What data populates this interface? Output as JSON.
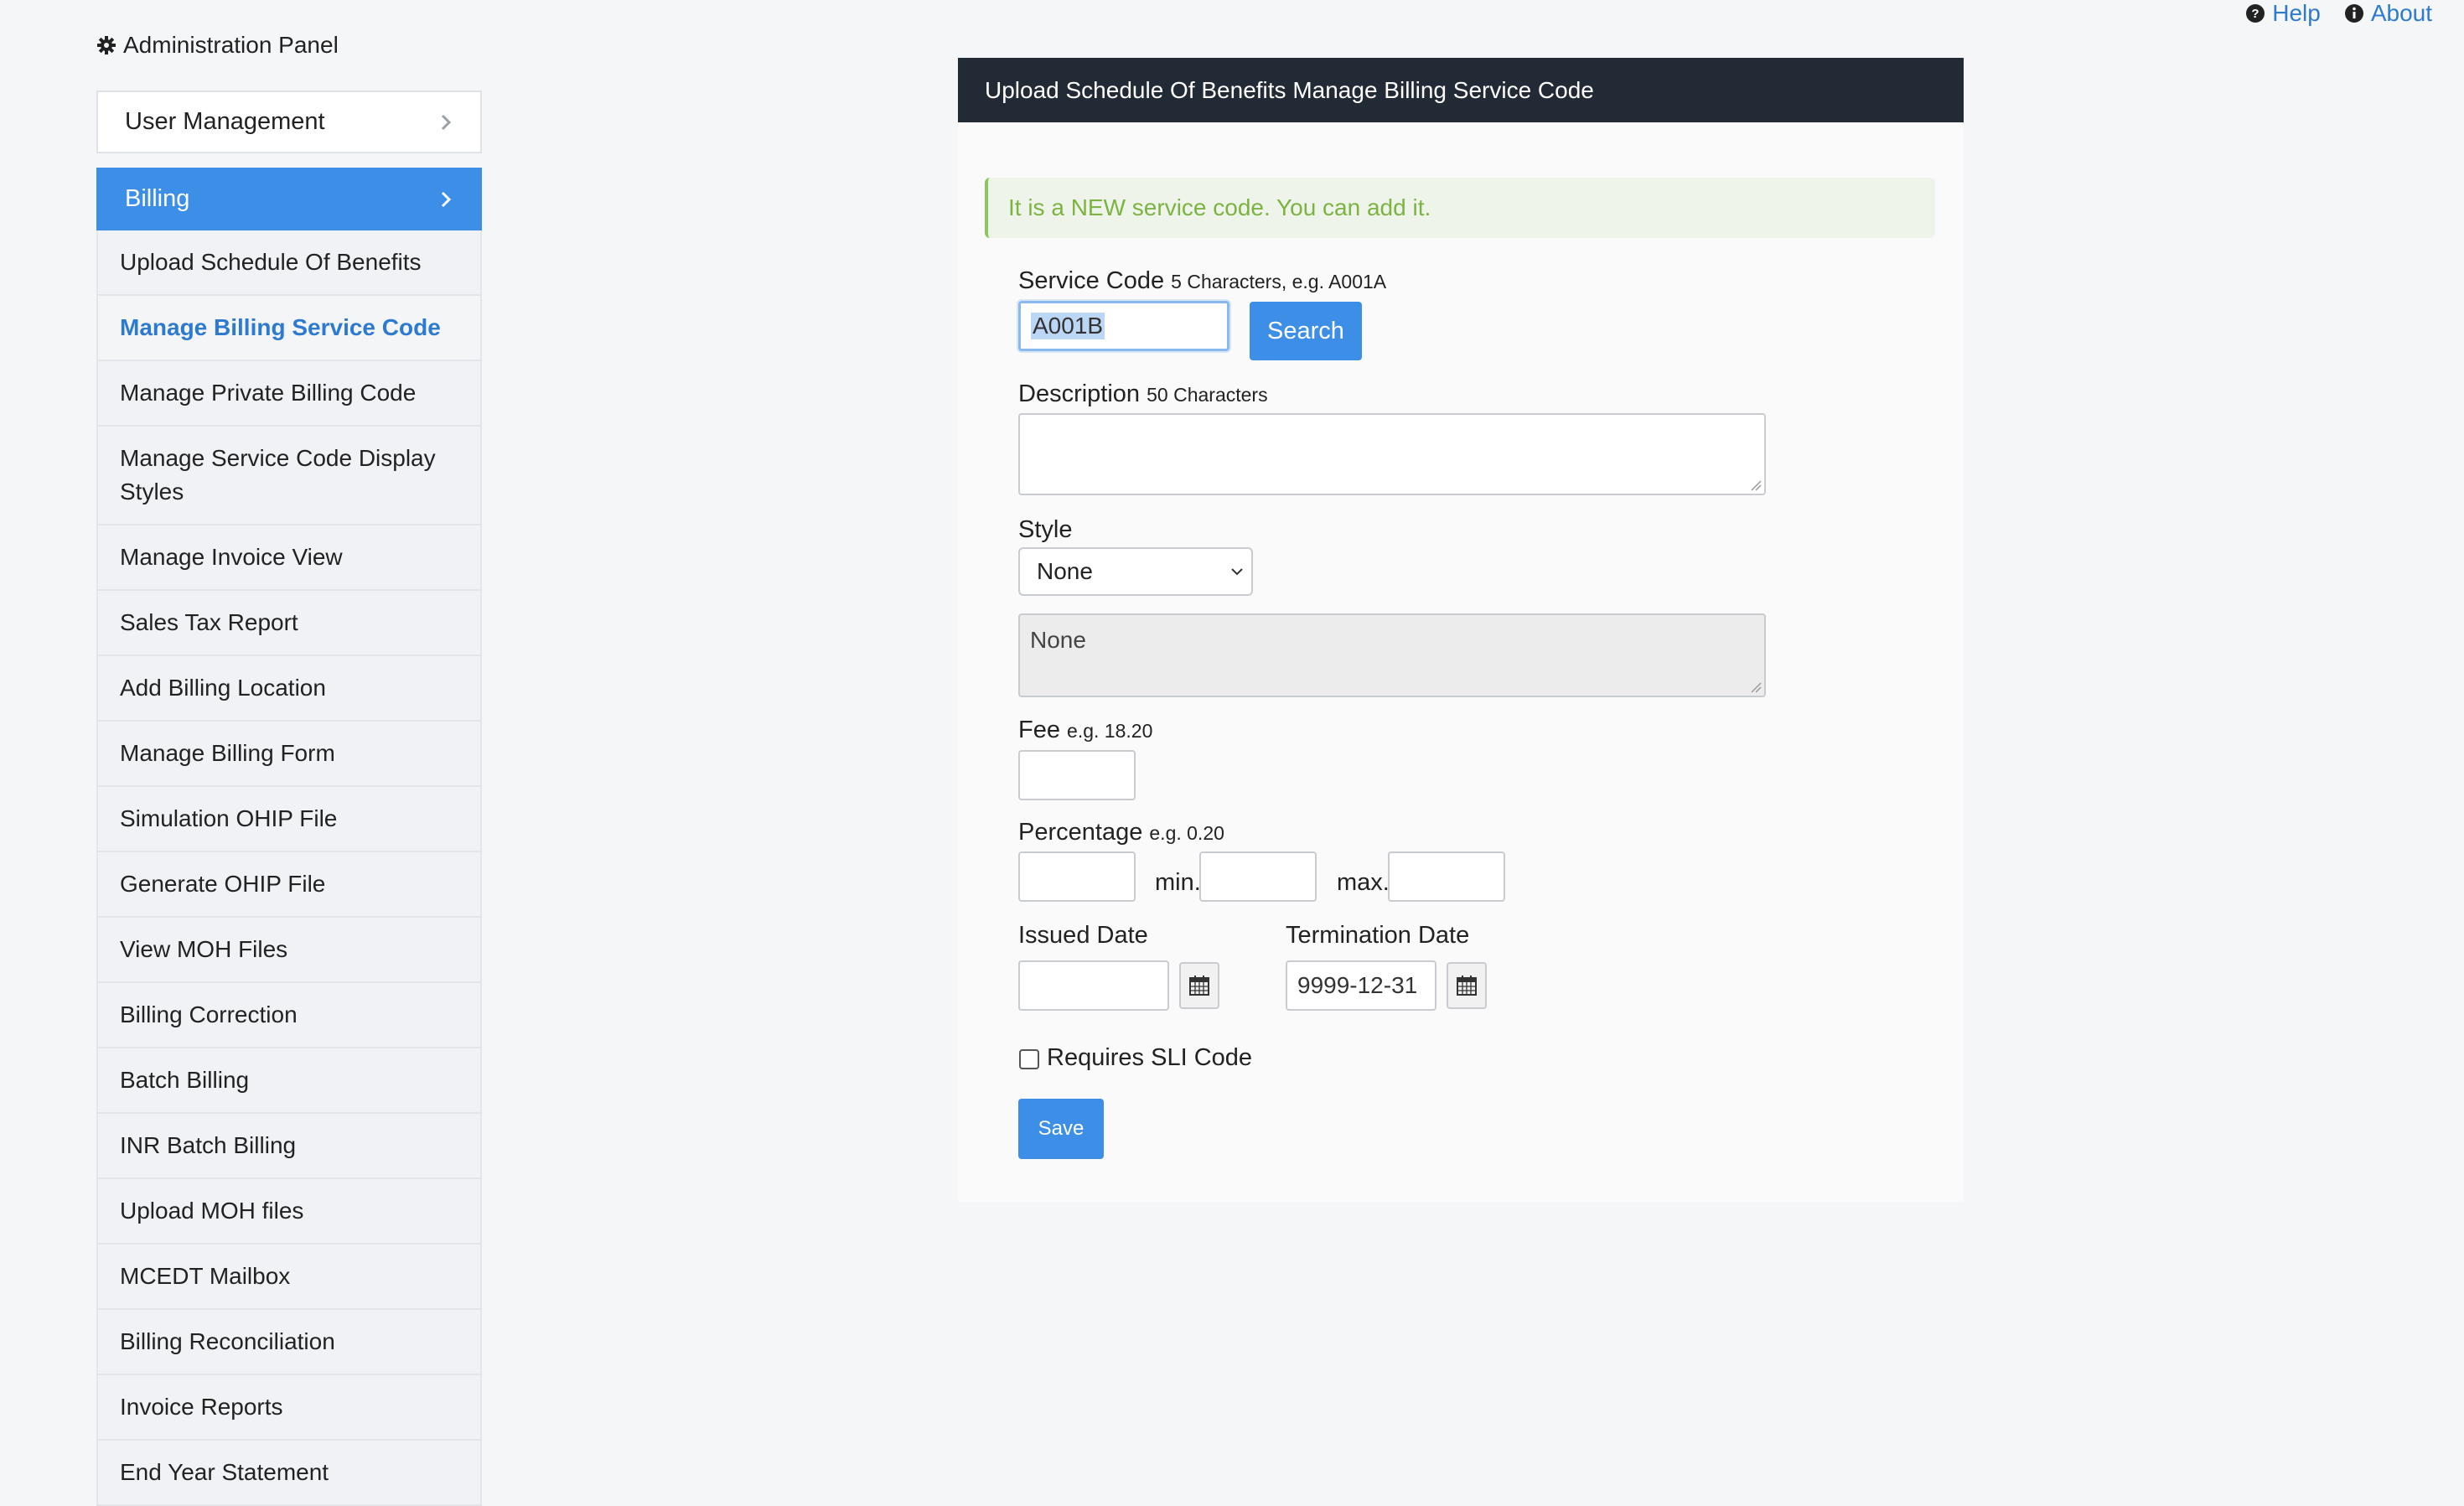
{
  "header": {
    "help_label": "Help",
    "about_label": "About",
    "admin_title": "Administration Panel"
  },
  "sidebar": {
    "user_management": "User Management",
    "billing": "Billing",
    "items": [
      "Upload Schedule Of Benefits",
      "Manage Billing Service Code",
      "Manage Private Billing Code",
      "Manage Service Code Display Styles",
      "Manage Invoice View",
      "Sales Tax Report",
      "Add Billing Location",
      "Manage Billing Form",
      "Simulation OHIP File",
      "Generate OHIP File",
      "View MOH Files",
      "Billing Correction",
      "Batch Billing",
      "INR Batch Billing",
      "Upload MOH files",
      "MCEDT Mailbox",
      "Billing Reconciliation",
      "Invoice Reports",
      "End Year Statement"
    ]
  },
  "panel": {
    "title": "Upload Schedule Of Benefits Manage Billing Service Code",
    "alert": "It is a NEW service code. You can add it.",
    "service_code_label": "Service Code",
    "service_code_hint": "5 Characters, e.g. A001A",
    "service_code_value": "A001B",
    "search_button": "Search",
    "description_label": "Description",
    "description_hint": "50 Characters",
    "style_label": "Style",
    "style_selected": "None",
    "style_preview": "None",
    "fee_label": "Fee",
    "fee_hint": "e.g. 18.20",
    "percentage_label": "Percentage",
    "percentage_hint": "e.g. 0.20",
    "min_label": "min.",
    "max_label": "max.",
    "issued_date_label": "Issued Date",
    "termination_date_label": "Termination Date",
    "termination_date_value": "9999-12-31",
    "sli_label": "Requires SLI Code",
    "save_button": "Save"
  }
}
